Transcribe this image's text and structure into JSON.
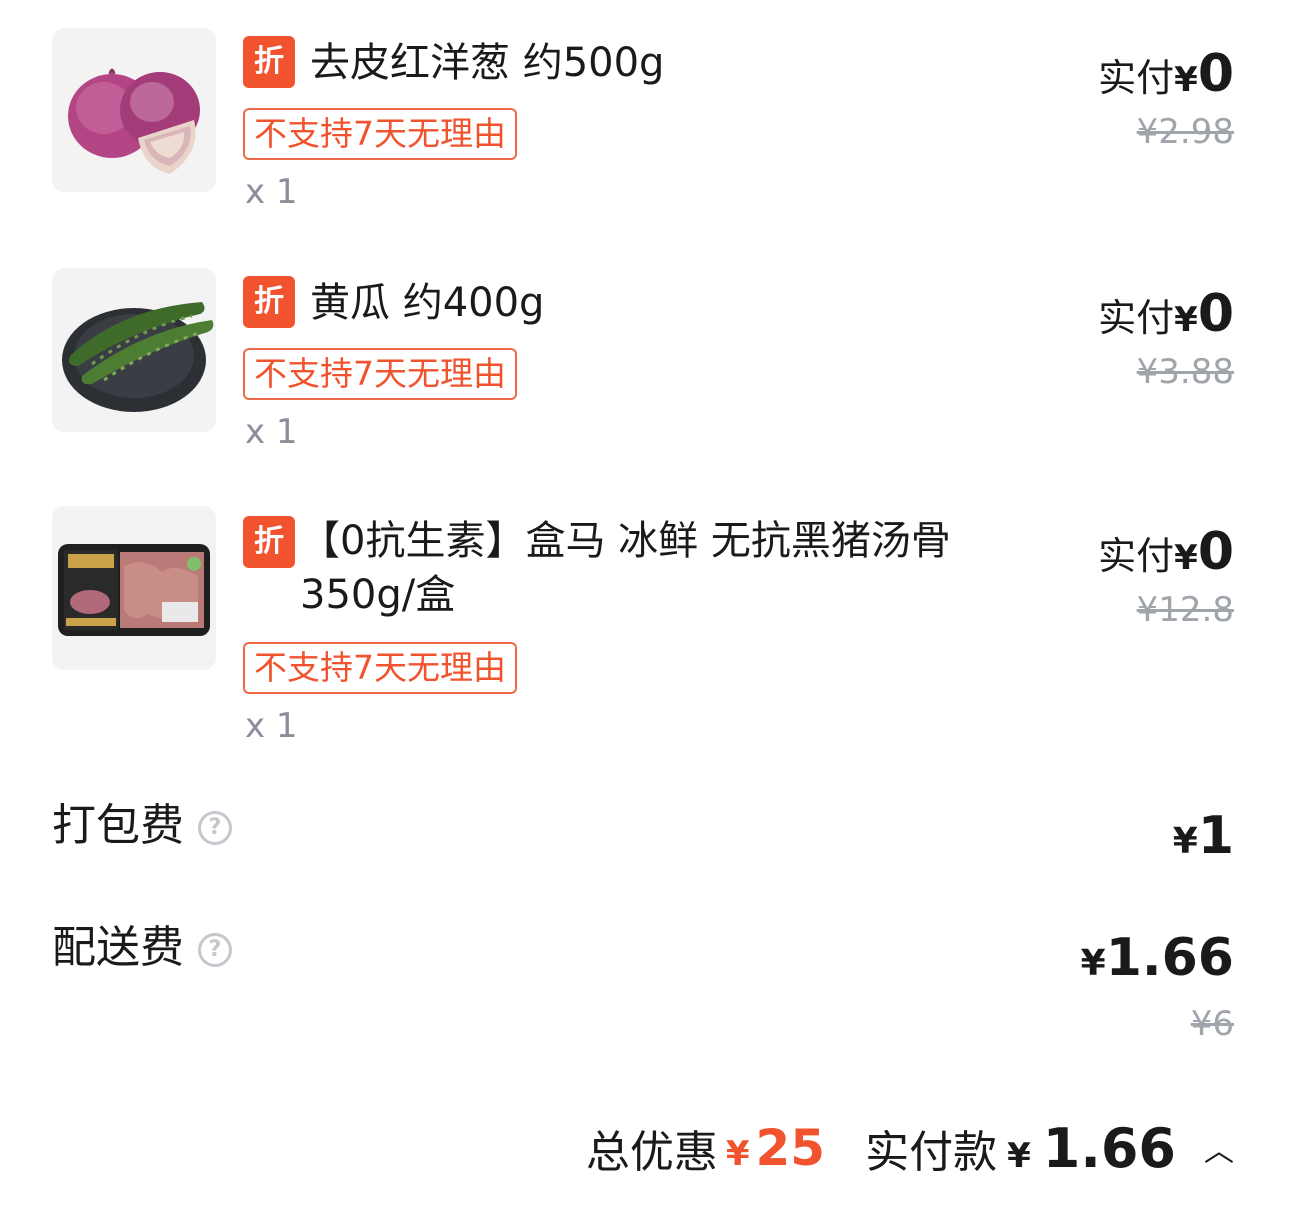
{
  "items": [
    {
      "discount_badge": "折",
      "name": "去皮红洋葱 约500g",
      "return_policy": "不支持7天无理由",
      "quantity": "x 1",
      "paid_label": "实付",
      "paid_currency": "¥",
      "paid_amount": "0",
      "original_price": "¥2.98",
      "image_icon": "red-onion-image"
    },
    {
      "discount_badge": "折",
      "name": "黄瓜 约400g",
      "return_policy": "不支持7天无理由",
      "quantity": "x 1",
      "paid_label": "实付",
      "paid_currency": "¥",
      "paid_amount": "0",
      "original_price": "¥3.88",
      "image_icon": "cucumber-image"
    },
    {
      "discount_badge": "折",
      "name": "【0抗生素】盒马 冰鲜 无抗黑猪汤骨 350g/盒",
      "return_policy": "不支持7天无理由",
      "quantity": "x 1",
      "paid_label": "实付",
      "paid_currency": "¥",
      "paid_amount": "0",
      "original_price": "¥12.8",
      "image_icon": "pork-bone-package-image"
    }
  ],
  "fees": {
    "packing": {
      "label": "打包费",
      "currency": "¥",
      "amount": "1",
      "help_icon": "question-circle-icon"
    },
    "delivery": {
      "label": "配送费",
      "currency": "¥",
      "amount": "1.66",
      "original": "¥6",
      "help_icon": "question-circle-icon"
    }
  },
  "footer": {
    "discount_label": "总优惠",
    "discount_currency": "¥",
    "discount_amount": "25",
    "paid_label": "实付款",
    "paid_currency": "¥",
    "paid_amount": "1.66",
    "expand_icon": "chevron-up-icon"
  },
  "colors": {
    "accent": "#f0532d",
    "muted": "#8a8f99",
    "strike": "#a0a4ab"
  }
}
